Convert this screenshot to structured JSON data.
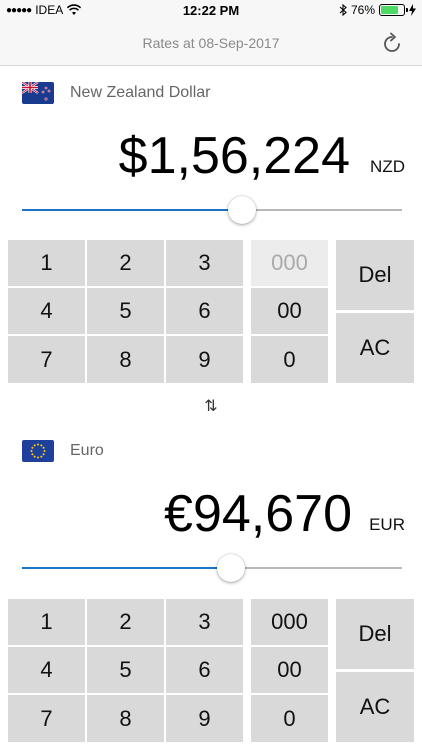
{
  "status_bar": {
    "signal": "●●●●●",
    "carrier": "IDEA",
    "time": "12:22 PM",
    "battery_percent": "76%",
    "battery_level": 0.76
  },
  "nav": {
    "title": "Rates at 08-Sep-2017"
  },
  "from_currency": {
    "name": "New Zealand Dollar",
    "amount": "$1,56,224",
    "code": "NZD",
    "slider_level": 0.58
  },
  "to_currency": {
    "name": "Euro",
    "amount": "€94,670",
    "code": "EUR",
    "slider_level": 0.55
  },
  "keypad_top": {
    "k1": "1",
    "k2": "2",
    "k3": "3",
    "k000": "000",
    "k4": "4",
    "k5": "5",
    "k6": "6",
    "k00": "00",
    "k7": "7",
    "k8": "8",
    "k9": "9",
    "k0": "0",
    "del": "Del",
    "ac": "AC"
  },
  "keypad_bottom": {
    "k1": "1",
    "k2": "2",
    "k3": "3",
    "k000": "000",
    "k4": "4",
    "k5": "5",
    "k6": "6",
    "k00": "00",
    "k7": "7",
    "k8": "8",
    "k9": "9",
    "k0": "0",
    "del": "Del",
    "ac": "AC"
  },
  "swap_symbol": "⇅",
  "colors": {
    "accent": "#1a73c8",
    "key_bg": "#d9d9d9",
    "battery": "#4cd964"
  }
}
